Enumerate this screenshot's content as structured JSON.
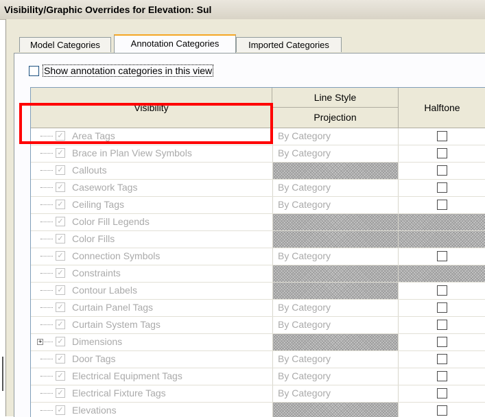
{
  "window": {
    "title": "Visibility/Graphic Overrides for Elevation: Sul"
  },
  "tabs": [
    {
      "label": "Model Categories",
      "active": false
    },
    {
      "label": "Annotation Categories",
      "active": true
    },
    {
      "label": "Imported Categories",
      "active": false
    }
  ],
  "show_annotation": {
    "label": "Show annotation categories in this view",
    "checked": false
  },
  "table": {
    "headers": {
      "visibility": "Visibility",
      "line_style": "Line Style",
      "projection": "Projection",
      "halftone": "Halftone"
    },
    "rows": [
      {
        "name": "Area Tags",
        "line_style": "By Category",
        "halftone": true
      },
      {
        "name": "Brace in Plan View Symbols",
        "line_style": "By Category",
        "halftone": true
      },
      {
        "name": "Callouts",
        "line_style": null,
        "halftone": true
      },
      {
        "name": "Casework Tags",
        "line_style": "By Category",
        "halftone": true
      },
      {
        "name": "Ceiling Tags",
        "line_style": "By Category",
        "halftone": true
      },
      {
        "name": "Color Fill Legends",
        "line_style": null,
        "halftone": null
      },
      {
        "name": "Color Fills",
        "line_style": null,
        "halftone": null
      },
      {
        "name": "Connection Symbols",
        "line_style": "By Category",
        "halftone": true
      },
      {
        "name": "Constraints",
        "line_style": null,
        "halftone": null
      },
      {
        "name": "Contour Labels",
        "line_style": null,
        "halftone": true
      },
      {
        "name": "Curtain Panel Tags",
        "line_style": "By Category",
        "halftone": true
      },
      {
        "name": "Curtain System Tags",
        "line_style": "By Category",
        "halftone": true
      },
      {
        "name": "Dimensions",
        "line_style": null,
        "halftone": true,
        "expandable": true
      },
      {
        "name": "Door Tags",
        "line_style": "By Category",
        "halftone": true
      },
      {
        "name": "Electrical Equipment Tags",
        "line_style": "By Category",
        "halftone": true
      },
      {
        "name": "Electrical Fixture Tags",
        "line_style": "By Category",
        "halftone": true
      },
      {
        "name": "Elevations",
        "line_style": null,
        "halftone": true
      }
    ]
  },
  "icons": {
    "check": "checkmark-icon",
    "expand": "plus-expand-icon"
  },
  "colors": {
    "highlight": "#ff0000",
    "active_tab_accent": "#f5a623"
  }
}
